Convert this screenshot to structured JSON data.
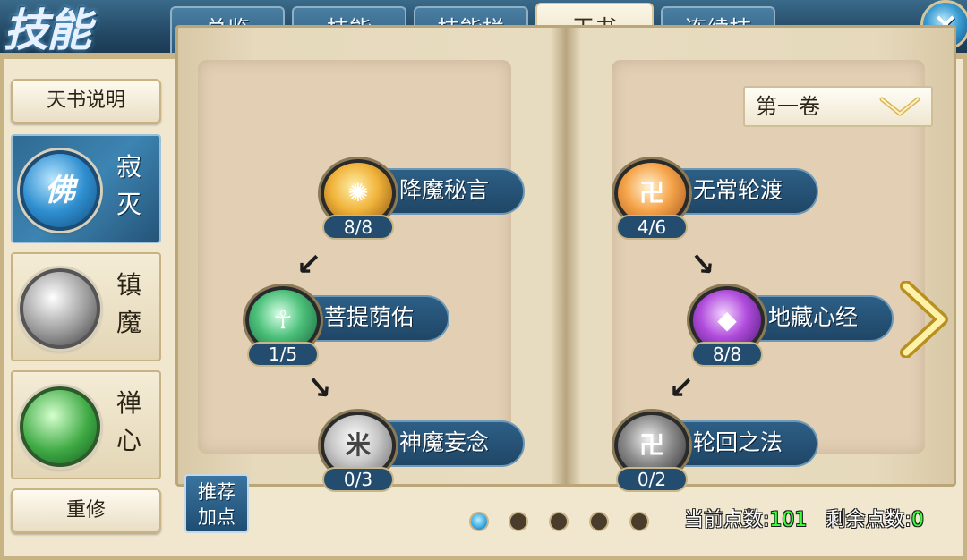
{
  "header": {
    "title": "技能",
    "tabs": [
      {
        "label": "总览",
        "active": false
      },
      {
        "label": "技能",
        "active": false
      },
      {
        "label": "技能栏",
        "active": false
      },
      {
        "label": "天书",
        "active": true
      },
      {
        "label": "连续技",
        "active": false
      }
    ],
    "close_icon": "×"
  },
  "sidebar": {
    "info_button": "天书说明",
    "categories": [
      {
        "label": "寂灭",
        "emblem": "佛",
        "active": true
      },
      {
        "label": "镇魔",
        "emblem": "",
        "active": false
      },
      {
        "label": "禅心",
        "emblem": "",
        "active": false
      }
    ],
    "reset_button": "重修"
  },
  "volume": {
    "selected": "第一卷",
    "icon": "chevron-down-icon"
  },
  "left_page": {
    "skills": [
      {
        "name": "降魔秘言",
        "level": "8/8",
        "orb": "gold"
      },
      {
        "name": "菩提荫佑",
        "level": "1/5",
        "orb": "green"
      },
      {
        "name": "神魔妄念",
        "level": "0/3",
        "orb": "silver"
      }
    ]
  },
  "right_page": {
    "skills": [
      {
        "name": "无常轮渡",
        "level": "4/6",
        "orb": "orange"
      },
      {
        "name": "地藏心经",
        "level": "8/8",
        "orb": "purple"
      },
      {
        "name": "轮回之法",
        "level": "0/2",
        "orb": "dark"
      }
    ]
  },
  "recommend": {
    "line1": "推荐",
    "line2": "加点"
  },
  "pagination": {
    "count": 5,
    "active_index": 0
  },
  "points": {
    "current_label": "当前点数:",
    "current_value": "101",
    "remaining_label": "剩余点数:",
    "remaining_value": "0"
  },
  "colors": {
    "accent_blue": "#2d5f86",
    "parchment": "#f1e7cf",
    "points_green": "#3cff3c"
  }
}
